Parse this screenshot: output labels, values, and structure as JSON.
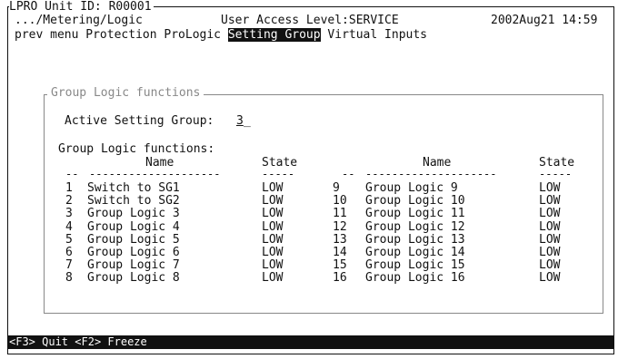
{
  "header": {
    "title": "LPRO Unit ID: R00001",
    "path": ".../Metering/Logic",
    "access": "User Access Level:SERVICE",
    "datetime": "2002Aug21 14:59"
  },
  "menu": {
    "prev": "prev menu",
    "protection": "Protection",
    "prologic": "ProLogic",
    "setting_group": "Setting Group",
    "virtual_inputs": "Virtual Inputs"
  },
  "group": {
    "legend": "Group Logic functions",
    "active_label": "Active Setting Group:",
    "active_value": "3",
    "cursor": "_",
    "list_label": "Group Logic functions:",
    "col_name": "Name",
    "col_state": "State",
    "dash_num": "--",
    "dash_name": "--------------------",
    "dash_state": "-----"
  },
  "left_rows": [
    {
      "num": "1",
      "name": "Switch to SG1",
      "state": "LOW"
    },
    {
      "num": "2",
      "name": "Switch to SG2",
      "state": "LOW"
    },
    {
      "num": "3",
      "name": "Group Logic 3",
      "state": "LOW"
    },
    {
      "num": "4",
      "name": "Group Logic 4",
      "state": "LOW"
    },
    {
      "num": "5",
      "name": "Group Logic 5",
      "state": "LOW"
    },
    {
      "num": "6",
      "name": "Group Logic 6",
      "state": "LOW"
    },
    {
      "num": "7",
      "name": "Group Logic 7",
      "state": "LOW"
    },
    {
      "num": "8",
      "name": "Group Logic 8",
      "state": "LOW"
    }
  ],
  "right_rows": [
    {
      "num": "9",
      "name": "Group Logic 9",
      "state": "LOW"
    },
    {
      "num": "10",
      "name": "Group Logic 10",
      "state": "LOW"
    },
    {
      "num": "11",
      "name": "Group Logic 11",
      "state": "LOW"
    },
    {
      "num": "12",
      "name": "Group Logic 12",
      "state": "LOW"
    },
    {
      "num": "13",
      "name": "Group Logic 13",
      "state": "LOW"
    },
    {
      "num": "14",
      "name": "Group Logic 14",
      "state": "LOW"
    },
    {
      "num": "15",
      "name": "Group Logic 15",
      "state": "LOW"
    },
    {
      "num": "16",
      "name": "Group Logic 16",
      "state": "LOW"
    }
  ],
  "status": {
    "quit": "<F3> Quit",
    "freeze": "<F2> Freeze"
  }
}
